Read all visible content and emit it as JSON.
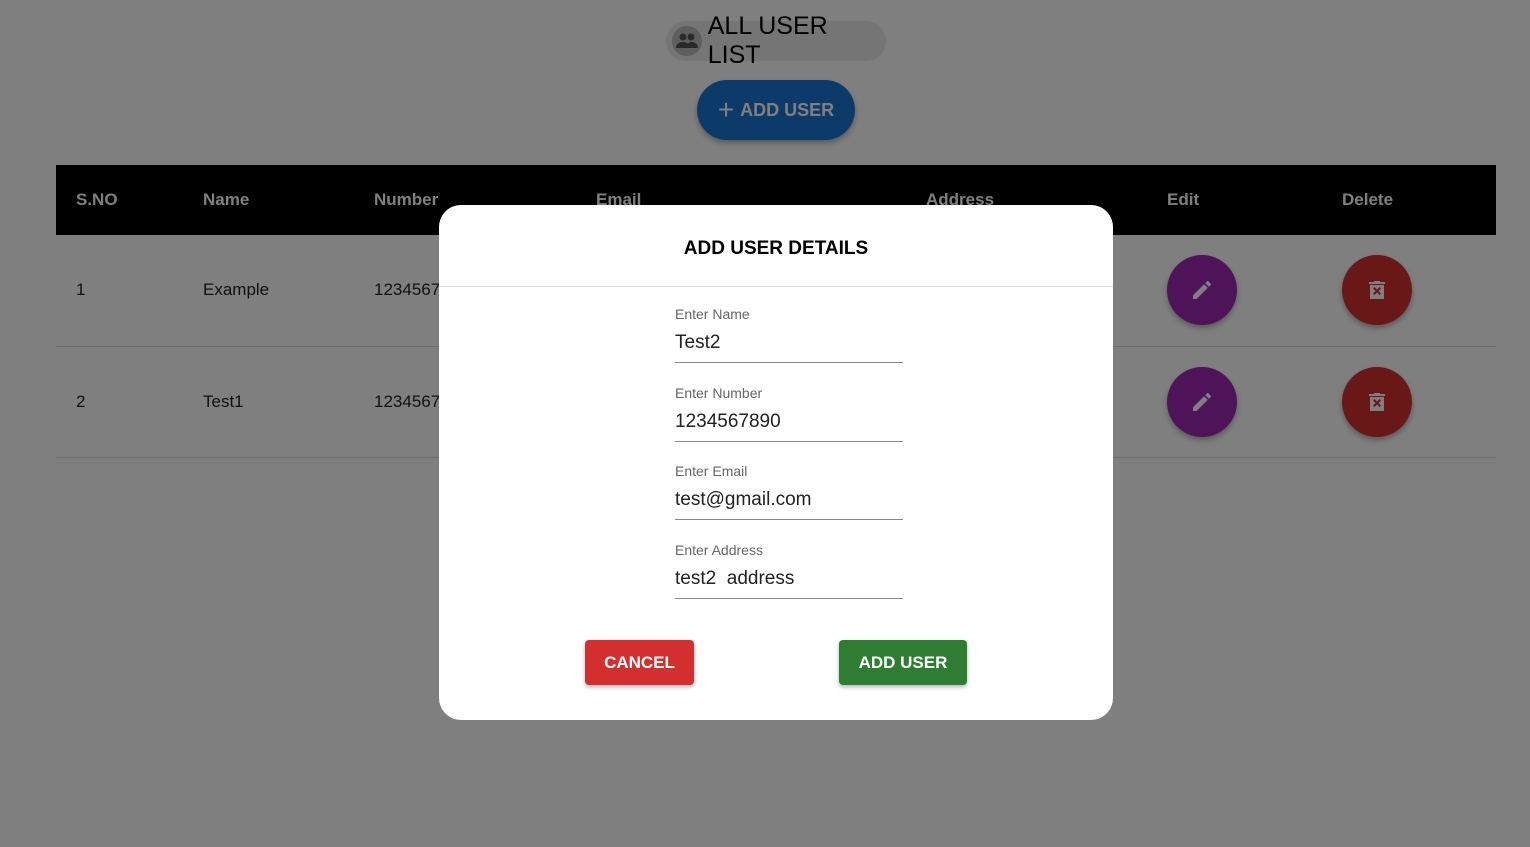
{
  "header": {
    "title": "ALL USER LIST",
    "title_icon": "group-icon",
    "add_button": "ADD USER"
  },
  "table": {
    "columns": [
      "S.NO",
      "Name",
      "Number",
      "Email",
      "Address",
      "Edit",
      "Delete"
    ],
    "rows": [
      {
        "sno": "1",
        "name": "Example",
        "number": "1234567"
      },
      {
        "sno": "2",
        "name": "Test1",
        "number": "1234567"
      }
    ]
  },
  "modal": {
    "title": "ADD USER DETAILS",
    "fields": [
      {
        "label": "Enter Name",
        "value": "Test2"
      },
      {
        "label": "Enter Number",
        "value": "1234567890"
      },
      {
        "label": "Enter Email",
        "value": "test@gmail.com"
      },
      {
        "label": "Enter Address",
        "value": "test2  address"
      }
    ],
    "cancel": "CANCEL",
    "submit": "ADD USER"
  },
  "colors": {
    "primary": "#1976d2",
    "edit": "#9c27b0",
    "delete": "#d32f2f",
    "submit": "#2e7d32"
  }
}
